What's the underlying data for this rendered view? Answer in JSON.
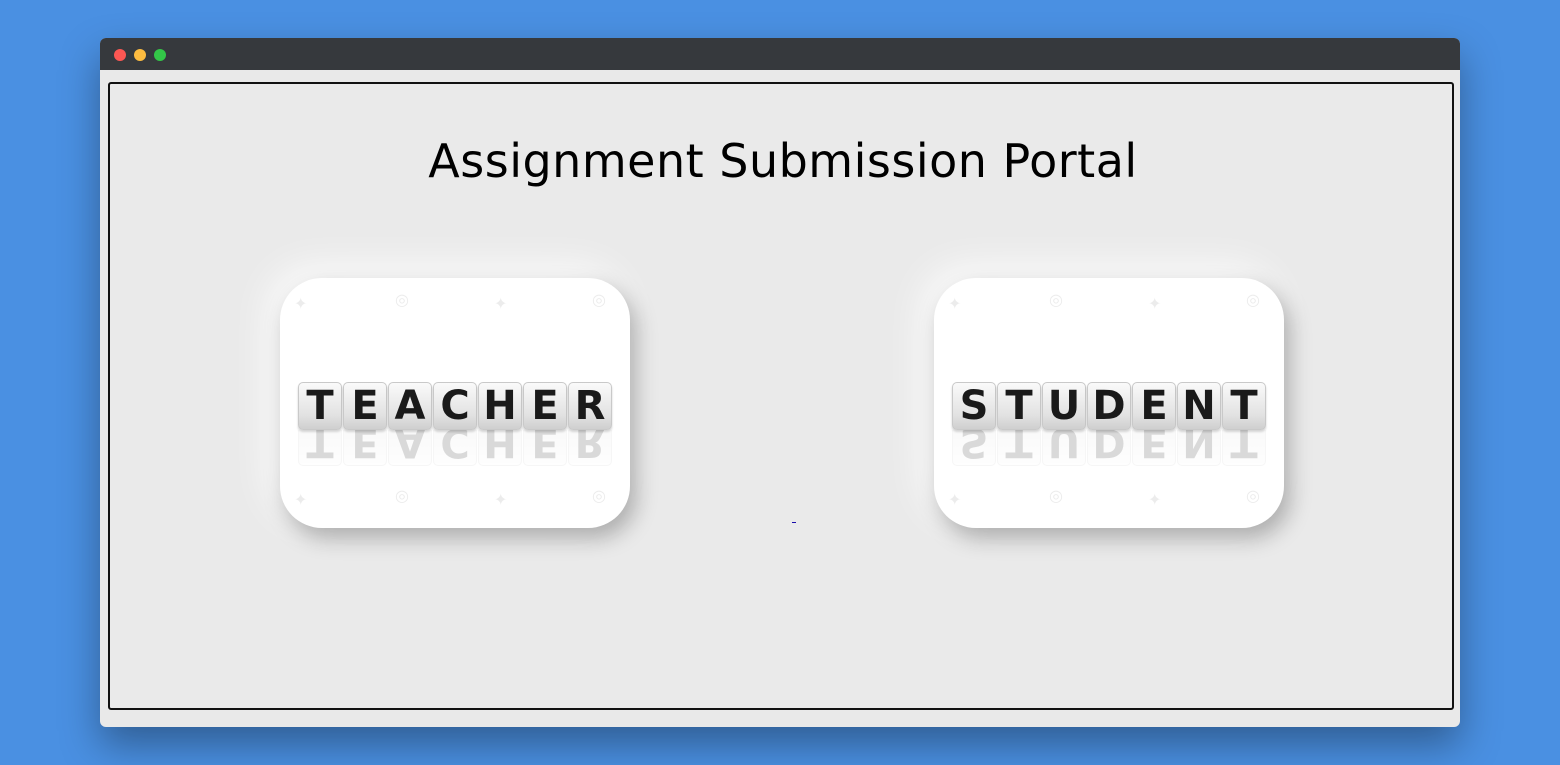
{
  "window": {
    "controls": [
      "close",
      "minimize",
      "maximize"
    ],
    "accent": "#4a90e2",
    "titlebar_color": "#36393d"
  },
  "page": {
    "title": "Assignment Submission Portal"
  },
  "cards": [
    {
      "id": "teacher",
      "letters": [
        "T",
        "E",
        "A",
        "C",
        "H",
        "E",
        "R"
      ]
    },
    {
      "id": "student",
      "letters": [
        "S",
        "T",
        "U",
        "D",
        "E",
        "N",
        "T"
      ]
    }
  ]
}
